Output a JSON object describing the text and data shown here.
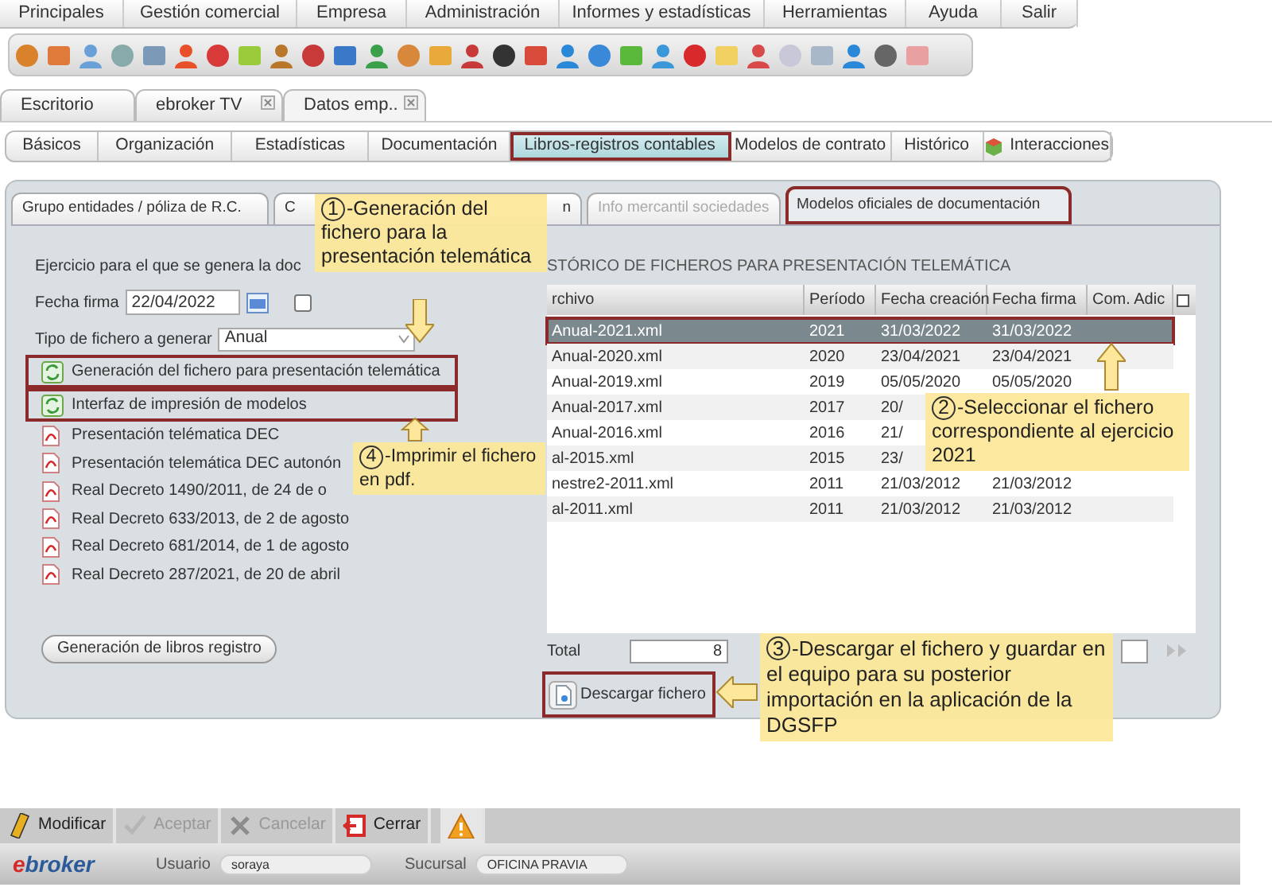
{
  "menu": [
    "Principales",
    "Gestión comercial",
    "Empresa",
    "Administración",
    "Informes y estadísticas",
    "Herramientas",
    "Ayuda",
    "Salir"
  ],
  "doc_tabs": [
    {
      "label": "Escritorio",
      "selected": false,
      "closable": false
    },
    {
      "label": "ebroker TV",
      "selected": false,
      "closable": true
    },
    {
      "label": "Datos emp..",
      "selected": true,
      "closable": true
    }
  ],
  "sub_tabs": [
    {
      "label": "Básicos",
      "selected": false,
      "highlighted": false
    },
    {
      "label": "Organización",
      "selected": false,
      "highlighted": false
    },
    {
      "label": "Estadísticas",
      "selected": false,
      "highlighted": false
    },
    {
      "label": "Documentación",
      "selected": false,
      "highlighted": false
    },
    {
      "label": "Libros-registros contables",
      "selected": true,
      "highlighted": true
    },
    {
      "label": "Modelos de contrato",
      "selected": false,
      "highlighted": false
    },
    {
      "label": "Histórico",
      "selected": false,
      "highlighted": false
    },
    {
      "label": "Interacciones",
      "selected": false,
      "highlighted": false,
      "kind": "icon"
    }
  ],
  "section_tabs": [
    {
      "label": "Grupo entidades / póliza de R.C.",
      "selected": false,
      "disabled": false,
      "highlighted": false
    },
    {
      "label": "C",
      "end_label": "n",
      "selected": false,
      "disabled": false,
      "highlighted": false
    },
    {
      "label": "Info mercantil sociedades",
      "selected": false,
      "disabled": true,
      "highlighted": false
    },
    {
      "label": "Modelos oficiales de documentación",
      "selected": true,
      "disabled": false,
      "highlighted": true
    }
  ],
  "form": {
    "exercise_label": "Ejercicio para el que se genera la doc",
    "date_label": "Fecha firma",
    "date_value": "22/04/2022",
    "checked": false,
    "type_label": "Tipo de fichero a generar",
    "type_value": "Anual"
  },
  "actions": [
    {
      "label": "Generación del fichero para presentación telemática",
      "highlighted": true
    },
    {
      "label": "Interfaz de impresión de modelos",
      "highlighted": true
    }
  ],
  "documents": [
    "Presentación telématica DEC",
    "Presentación telemática DEC autonón",
    "Real Decreto 1490/2011, de 24 de o",
    "Real Decreto 633/2013, de 2 de agosto",
    "Real Decreto 681/2014, de 1 de agosto",
    "Real Decreto 287/2021, de 20 de abril"
  ],
  "books_button": "Generación de libros registro",
  "history": {
    "title": "STÓRICO DE FICHEROS PARA PRESENTACIÓN TELEMÁTICA",
    "columns": [
      "rchivo",
      "Período",
      "Fecha creación",
      "Fecha firma",
      "Com. Adic"
    ],
    "rows": [
      {
        "file": "Anual-2021.xml",
        "period": "2021",
        "created": "31/03/2022",
        "signed": "31/03/2022",
        "selected": true,
        "highlighted": true
      },
      {
        "file": "Anual-2020.xml",
        "period": "2020",
        "created": "23/04/2021",
        "signed": "23/04/2021",
        "selected": false,
        "highlighted": false
      },
      {
        "file": "Anual-2019.xml",
        "period": "2019",
        "created": "05/05/2020",
        "signed": "05/05/2020",
        "selected": false,
        "highlighted": false
      },
      {
        "file": "Anual-2017.xml",
        "period": "2017",
        "created": "20/",
        "selected": false,
        "highlighted": false
      },
      {
        "file": "Anual-2016.xml",
        "period": "2016",
        "created": "21/",
        "selected": false,
        "highlighted": false
      },
      {
        "file": "al-2015.xml",
        "period": "2015",
        "created": "23/",
        "selected": false,
        "highlighted": false
      },
      {
        "file": "nestre2-2011.xml",
        "period": "2011",
        "created": "21/03/2012",
        "signed": "21/03/2012",
        "selected": false,
        "highlighted": false
      },
      {
        "file": "al-2011.xml",
        "period": "2011",
        "created": "21/03/2012",
        "signed": "21/03/2012",
        "selected": false,
        "highlighted": false
      }
    ]
  },
  "total_label": "Total",
  "total_value": "8",
  "download_button": {
    "label": "Descargar fichero",
    "highlighted": true
  },
  "callouts": [
    {
      "number": "1",
      "text": "-Generación del fichero para la presentación telemática"
    },
    {
      "number": "2",
      "text": "-Seleccionar el fichero correspondiente al ejercicio 2021"
    },
    {
      "number": "3",
      "text": "-Descargar el fichero y guardar en el equipo para su posterior importación en la aplicación de la DGSFP"
    },
    {
      "number": "4",
      "text": "-Imprimir el fichero en pdf."
    }
  ],
  "bottom_actions": [
    {
      "kind": "edit",
      "label": "Modificar",
      "disabled": false
    },
    {
      "kind": "accept",
      "label": "Aceptar",
      "disabled": true
    },
    {
      "kind": "cancel",
      "label": "Cancelar",
      "disabled": true
    },
    {
      "kind": "close",
      "label": "Cerrar",
      "disabled": false
    },
    {
      "kind": "warning",
      "disabled": false
    }
  ],
  "status": {
    "logo": "ebroker",
    "user_label": "Usuario",
    "user": "soraya",
    "branch_label": "Sucursal",
    "branch": "OFICINA PRAVIA"
  }
}
